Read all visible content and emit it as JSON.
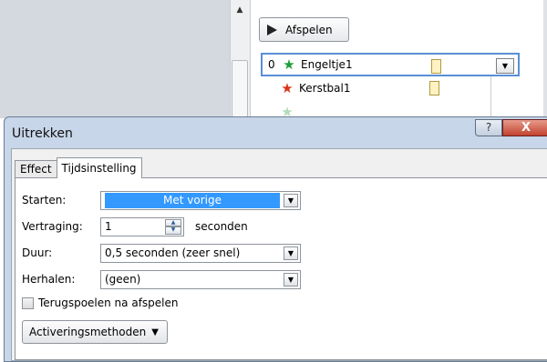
{
  "background": {
    "play_button_label": "Afspelen",
    "animations": [
      {
        "order": "0",
        "name": "Engeltje1",
        "star_color": "#1f9d3a"
      },
      {
        "order": "",
        "name": "Kerstbal1",
        "star_color": "#d8361b"
      }
    ]
  },
  "dialog": {
    "title": "Uitrekken",
    "help_label": "?",
    "close_label": "X",
    "tabs": [
      {
        "label": "Effect",
        "active": false
      },
      {
        "label": "Tijdsinstelling",
        "active": true
      }
    ],
    "fields": {
      "start": {
        "label": "Starten:",
        "value": "Met vorige"
      },
      "delay": {
        "label": "Vertraging:",
        "value": "1",
        "unit": "seconden"
      },
      "duration": {
        "label": "Duur:",
        "value": "0,5 seconden (zeer snel)"
      },
      "repeat": {
        "label": "Herhalen:",
        "value": "(geen)"
      }
    },
    "rewind_label": "Terugspoelen na afspelen",
    "triggers_label": "Activeringsmethoden"
  },
  "colors": {
    "selection": "#3399ff",
    "close_button": "#c2432f",
    "timing_bar": "#fff2c2"
  }
}
